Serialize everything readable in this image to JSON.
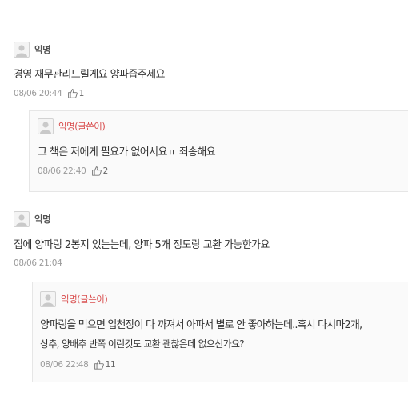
{
  "comments": [
    {
      "author": "익명",
      "text": "경영 재무관리드릴게요 양파즙주세요",
      "date": "08/06 20:44",
      "likes": "1",
      "reply": {
        "author": "익명(글쓴이)",
        "text": "그 책은 저에게 필요가 없어서요ㅠ 죄송해요",
        "date": "08/06 22:40",
        "likes": "2"
      }
    },
    {
      "author": "익명",
      "text": "집에 양파링 2봉지 있는는데, 양파 5개 정도랑 교환 가능한가요",
      "date": "08/06 21:04",
      "reply": {
        "author": "익명(글쓴이)",
        "text_line1": "양파링을 먹으면 입천장이 다 까져서 아파서 별로 안 좋아하는데..혹시 다시마2개,",
        "text_line2": "상추, 양배추 반쪽 이런것도 교환 괜찮은데 없으신가요?",
        "date": "08/06 22:48",
        "likes": "11"
      }
    }
  ]
}
